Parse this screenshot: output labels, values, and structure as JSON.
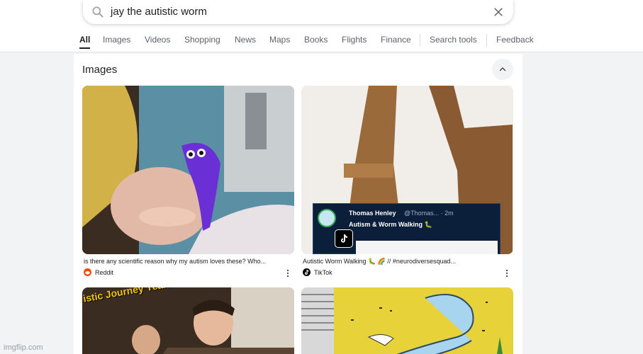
{
  "search": {
    "query": "jay the autistic worm",
    "icon": "search-icon",
    "clear_icon": "close-icon"
  },
  "tabs": [
    {
      "label": "All",
      "active": true
    },
    {
      "label": "Images"
    },
    {
      "label": "Videos"
    },
    {
      "label": "Shopping"
    },
    {
      "label": "News"
    },
    {
      "label": "Maps"
    },
    {
      "label": "Books"
    },
    {
      "label": "Flights"
    },
    {
      "label": "Finance"
    },
    {
      "label": "Search tools"
    },
    {
      "label": "Feedback"
    }
  ],
  "images_section": {
    "title": "Images",
    "collapse_icon": "chevron-up-icon",
    "results": [
      {
        "caption": "is there any scientific reason why my autism loves these? Who...",
        "source": "Reddit",
        "favicon": "reddit-icon",
        "thumb": {
          "main": "#4a3a2e",
          "accent": "#6b2fd6"
        }
      },
      {
        "caption": "Autistic Worm Walking 🐛 🌈 // #neurodiversesquad...",
        "source": "TikTok",
        "favicon": "tiktok-icon",
        "overlay_name": "Thomas Henley",
        "overlay_handle": "@Thomas... · 2m",
        "overlay_text": "Autism & Worm Walking 🐛",
        "thumb": {
          "main": "#f1ede9",
          "accent": "#8a5a32"
        }
      },
      {
        "banner_text": "istic Journey Years and Beyond",
        "thumb": {
          "main": "#3a2c20",
          "accent": "#f2c40f"
        }
      },
      {
        "thumb": {
          "main": "#e8d23a",
          "accent": "#5aa7d8"
        }
      }
    ]
  },
  "watermark": "imgflip.com",
  "colors": {
    "page_bg": "#f1f3f4",
    "panel_bg": "#ffffff",
    "reddit": "#ff4500",
    "tiktok": "#000000"
  }
}
